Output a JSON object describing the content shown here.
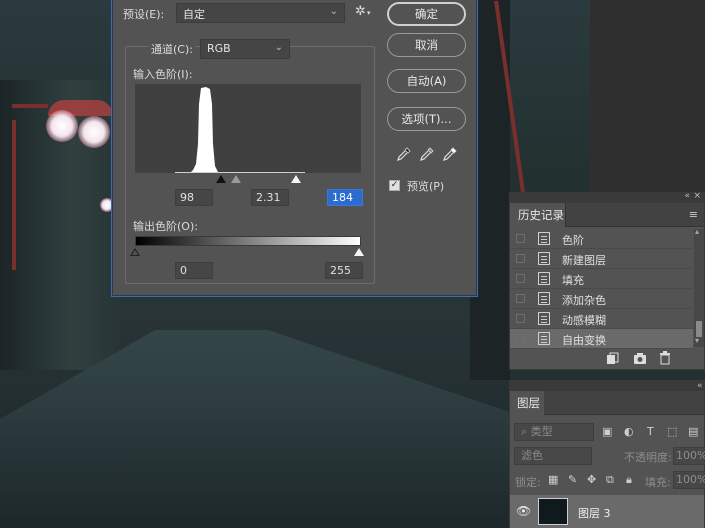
{
  "levels": {
    "preset_label": "预设(E):",
    "preset_value": "自定",
    "channel_label": "通道(C):",
    "channel_value": "RGB",
    "input_levels_label": "输入色阶(I):",
    "input_black": "98",
    "input_gamma": "2.31",
    "input_white": "184",
    "output_levels_label": "输出色阶(O):",
    "output_black": "0",
    "output_white": "255",
    "buttons": {
      "ok": "确定",
      "cancel": "取消",
      "auto": "自动(A)",
      "options": "选项(T)..."
    },
    "preview_label": "预览(P)",
    "preview_checked": true,
    "histogram_shape": "narrow peak",
    "colors": {
      "selected_field": "#2c6bd0",
      "dialog_bg": "#535353"
    }
  },
  "history_panel": {
    "tab": "历史记录",
    "items": [
      {
        "label": "色阶",
        "active": false
      },
      {
        "label": "新建图层",
        "active": false
      },
      {
        "label": "填充",
        "active": false
      },
      {
        "label": "添加杂色",
        "active": false
      },
      {
        "label": "动感模糊",
        "active": false
      },
      {
        "label": "自由变换",
        "active": true
      }
    ],
    "icons": [
      "new-snapshot-icon",
      "camera-icon",
      "trash-icon"
    ]
  },
  "layers_panel": {
    "tab": "图层",
    "filter_placeholder": "类型",
    "blend_mode": "滤色",
    "opacity_label": "不透明度:",
    "opacity_value": "100%",
    "lock_label": "锁定:",
    "fill_label": "填充:",
    "fill_value": "100%",
    "layer_name": "图层 3"
  }
}
